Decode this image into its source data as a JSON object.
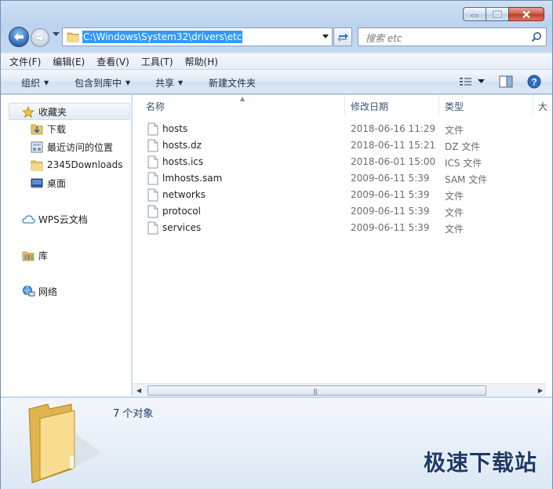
{
  "address": {
    "path": "C:\\Windows\\System32\\drivers\\etc"
  },
  "search": {
    "placeholder": "搜索 etc"
  },
  "menu": [
    "文件(F)",
    "编辑(E)",
    "查看(V)",
    "工具(T)",
    "帮助(H)"
  ],
  "toolbar": {
    "organize": "组织",
    "include_in_library": "包含到库中",
    "share": "共享",
    "new_folder": "新建文件夹"
  },
  "nav": {
    "favorites": "收藏夹",
    "downloads": "下载",
    "recent": "最近访问的位置",
    "downloads2345": "2345Downloads",
    "desktop": "桌面",
    "wps": "WPS云文档",
    "library": "库",
    "network": "网络"
  },
  "columns": {
    "name": "名称",
    "date": "修改日期",
    "type": "类型",
    "size": "大"
  },
  "files": [
    {
      "name": "hosts",
      "date": "2018-06-16 11:29",
      "type": "文件"
    },
    {
      "name": "hosts.dz",
      "date": "2018-06-11 15:21",
      "type": "DZ 文件"
    },
    {
      "name": "hosts.ics",
      "date": "2018-06-01 15:00",
      "type": "ICS 文件"
    },
    {
      "name": "lmhosts.sam",
      "date": "2009-06-11 5:39",
      "type": "SAM 文件"
    },
    {
      "name": "networks",
      "date": "2009-06-11 5:39",
      "type": "文件"
    },
    {
      "name": "protocol",
      "date": "2009-06-11 5:39",
      "type": "文件"
    },
    {
      "name": "services",
      "date": "2009-06-11 5:39",
      "type": "文件"
    }
  ],
  "status": {
    "count": "7 个对象"
  },
  "watermark": "极速下载站",
  "colors": {
    "selection": "#3399ff",
    "chrome": "#c6d9f0",
    "link_text": "#1b2f4c"
  }
}
